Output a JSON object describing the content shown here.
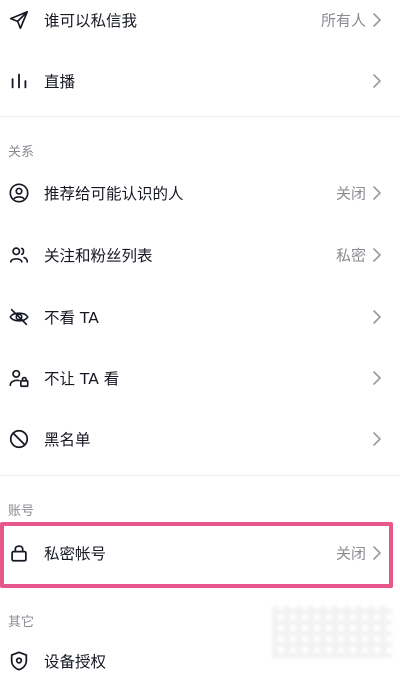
{
  "rows": {
    "private_message": {
      "label": "谁可以私信我",
      "value": "所有人",
      "icon": "send-icon"
    },
    "live": {
      "label": "直播",
      "icon": "bar-chart-icon"
    },
    "recommend": {
      "label": "推荐给可能认识的人",
      "value": "关闭",
      "icon": "user-circle-icon"
    },
    "follow_list": {
      "label": "关注和粉丝列表",
      "value": "私密",
      "icon": "users-icon"
    },
    "hide_their": {
      "label": "不看 TA",
      "icon": "eye-off-icon"
    },
    "hide_mine": {
      "label": "不让 TA 看",
      "icon": "user-lock-icon"
    },
    "blacklist": {
      "label": "黑名单",
      "icon": "block-icon"
    },
    "private_account": {
      "label": "私密帐号",
      "value": "关闭",
      "icon": "lock-icon"
    },
    "device_auth": {
      "label": "设备授权",
      "icon": "shield-icon"
    }
  },
  "sections": {
    "relations": "关系",
    "account": "账号",
    "other": "其它"
  },
  "colors": {
    "text_primary": "#161823",
    "text_secondary": "#8a8b91",
    "divider": "#ececee",
    "highlight": "#e8578c"
  }
}
